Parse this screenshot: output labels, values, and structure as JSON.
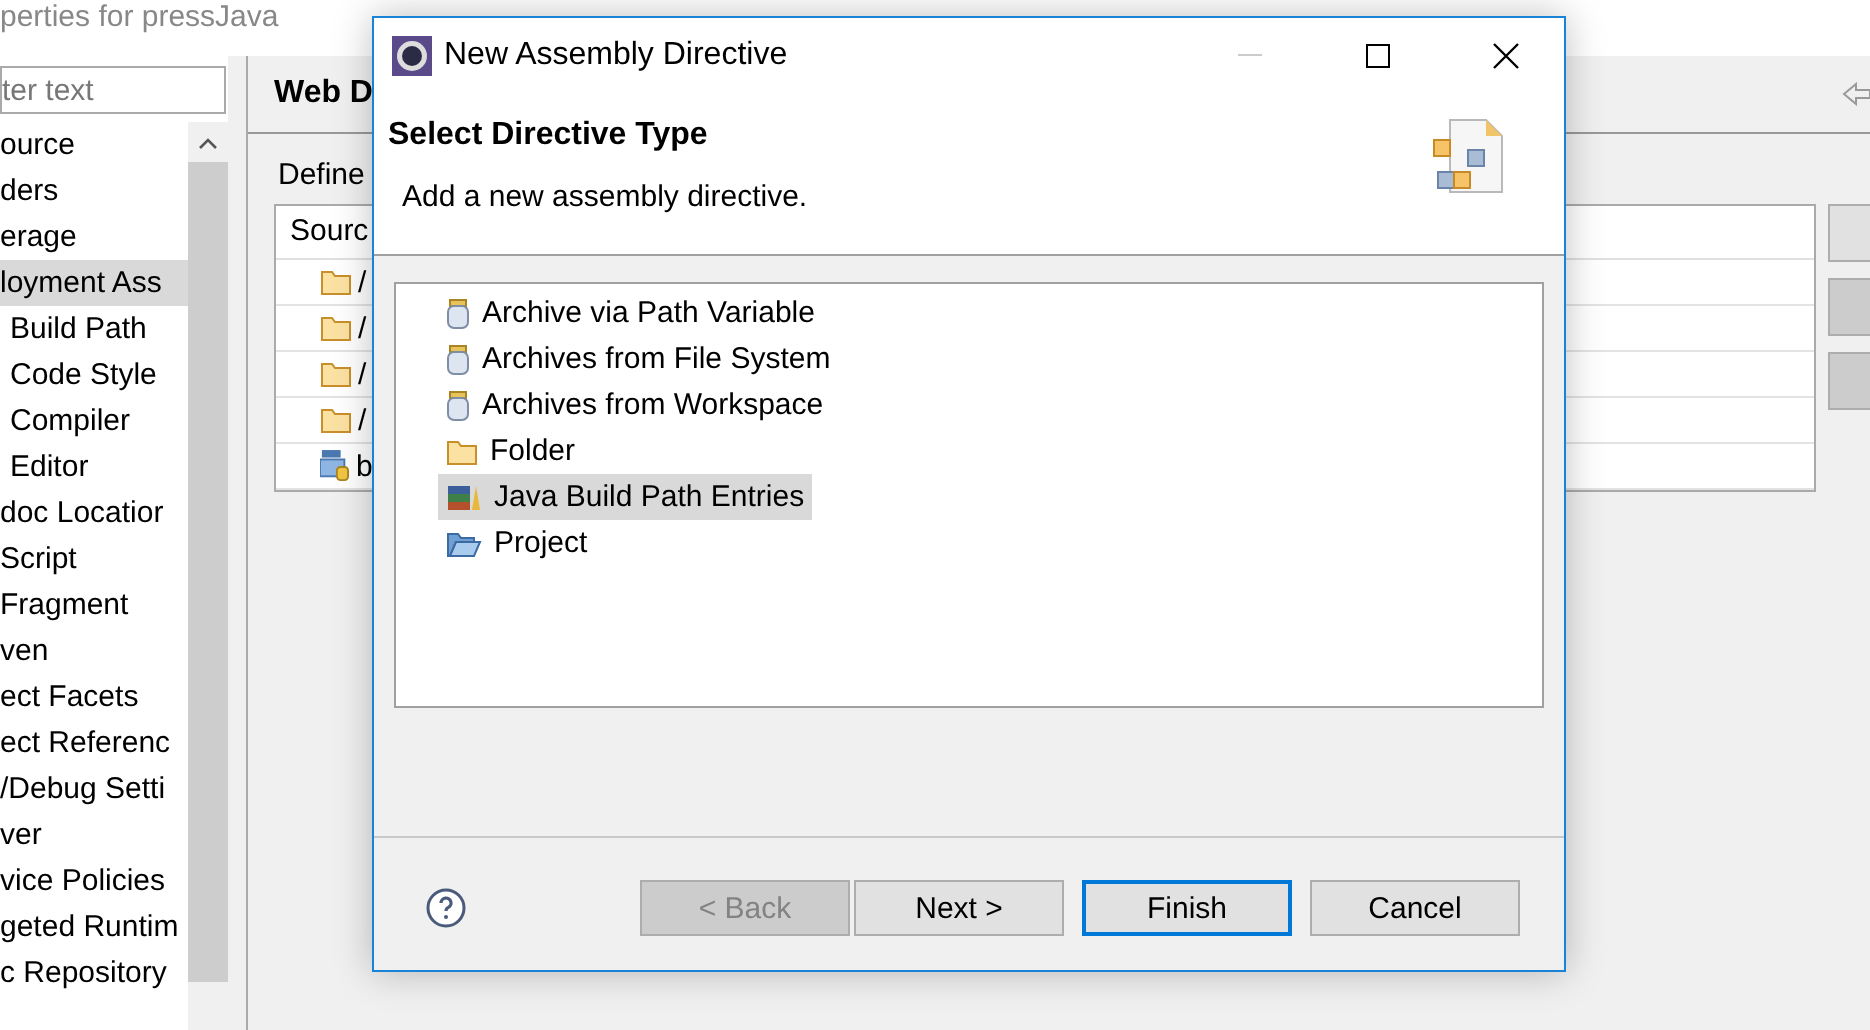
{
  "background_window": {
    "title": "perties for pressJava",
    "filter": {
      "placeholder": "ter text"
    },
    "tree_items": [
      {
        "label": "ource",
        "selected": false
      },
      {
        "label": "ders",
        "selected": false
      },
      {
        "label": "erage",
        "selected": false
      },
      {
        "label": "loyment Ass",
        "selected": true
      },
      {
        "label": "Build Path",
        "selected": false
      },
      {
        "label": "Code Style",
        "selected": false
      },
      {
        "label": "Compiler",
        "selected": false
      },
      {
        "label": "Editor",
        "selected": false
      },
      {
        "label": "doc Locatior",
        "selected": false
      },
      {
        "label": "Script",
        "selected": false
      },
      {
        "label": "Fragment",
        "selected": false
      },
      {
        "label": "ven",
        "selected": false
      },
      {
        "label": "ect Facets",
        "selected": false
      },
      {
        "label": "ect Referenc",
        "selected": false
      },
      {
        "label": "/Debug Setti",
        "selected": false
      },
      {
        "label": "ver",
        "selected": false
      },
      {
        "label": "vice Policies",
        "selected": false
      },
      {
        "label": "geted Runtim",
        "selected": false
      },
      {
        "label": "c Repository",
        "selected": false
      }
    ],
    "page_title": "Web D",
    "description": "Define",
    "table": {
      "columns": [
        "Sourc"
      ],
      "rows": [
        {
          "kind": "folder",
          "text": "/"
        },
        {
          "kind": "folder",
          "text": "/"
        },
        {
          "kind": "folder",
          "text": "/"
        },
        {
          "kind": "folder",
          "text": "/"
        },
        {
          "kind": "library",
          "text": "b"
        }
      ]
    }
  },
  "dialog": {
    "title": "New Assembly Directive",
    "heading": "Select Directive Type",
    "message": "Add a new assembly directive.",
    "options": [
      {
        "label": "Archive via Path Variable",
        "kind": "jar",
        "selected": false
      },
      {
        "label": "Archives from File System",
        "kind": "jar",
        "selected": false
      },
      {
        "label": "Archives from Workspace",
        "kind": "jar",
        "selected": false
      },
      {
        "label": "Folder",
        "kind": "folder",
        "selected": false
      },
      {
        "label": "Java Build Path Entries",
        "kind": "books",
        "selected": true
      },
      {
        "label": "Project",
        "kind": "project",
        "selected": false
      }
    ],
    "buttons": [
      {
        "label": "< Back",
        "disabled": true,
        "focused": false
      },
      {
        "label": "Next >",
        "disabled": false,
        "focused": false
      },
      {
        "label": "Finish",
        "disabled": false,
        "focused": true
      },
      {
        "label": "Cancel",
        "disabled": false,
        "focused": false
      }
    ]
  }
}
